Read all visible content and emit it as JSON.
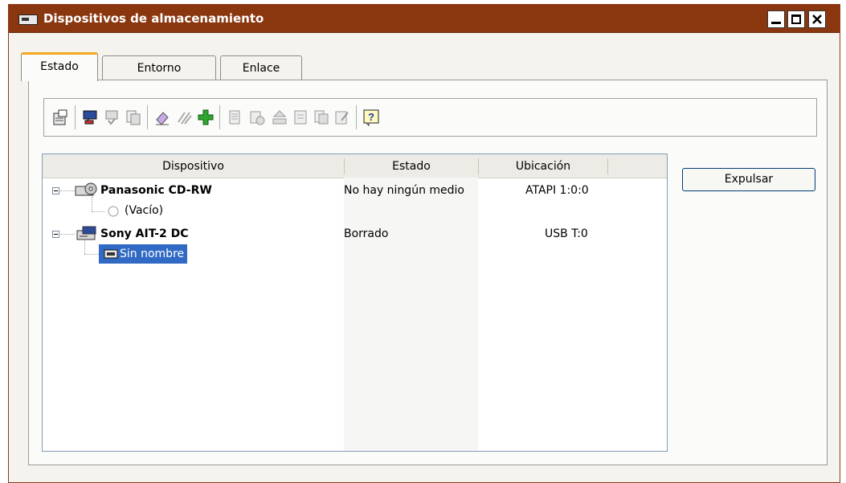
{
  "window": {
    "title": "Dispositivos de almacenamiento"
  },
  "tabs": [
    {
      "label": "Estado",
      "active": true
    },
    {
      "label": "Entorno",
      "active": false
    },
    {
      "label": "Enlace",
      "active": false
    }
  ],
  "toolbar": {
    "icons": [
      "properties-icon",
      "message-icon",
      "check-icon",
      "copy-icon",
      "erase-icon",
      "scan-icon",
      "add-icon",
      "list-icon",
      "media-icon",
      "eject-tray-icon",
      "label-icon",
      "duplicate-icon",
      "edit-icon",
      "help-icon"
    ]
  },
  "list": {
    "headers": [
      "Dispositivo",
      "Estado",
      "Ubicación"
    ],
    "rows": [
      {
        "name": "Panasonic CD-RW",
        "status": "No hay ningún medio",
        "location": "ATAPI 1:0:0"
      },
      {
        "name": "(Vacío)",
        "status": "",
        "location": ""
      },
      {
        "name": "Sony AIT-2 DC",
        "status": "Borrado",
        "location": "USB T:0"
      },
      {
        "name": "Sin nombre",
        "status": "",
        "location": ""
      }
    ]
  },
  "buttons": {
    "eject": "Expulsar"
  },
  "colors": {
    "titlebar": "#8a3710",
    "selection": "#316ac5",
    "active_tab_accent": "#f5a623"
  }
}
